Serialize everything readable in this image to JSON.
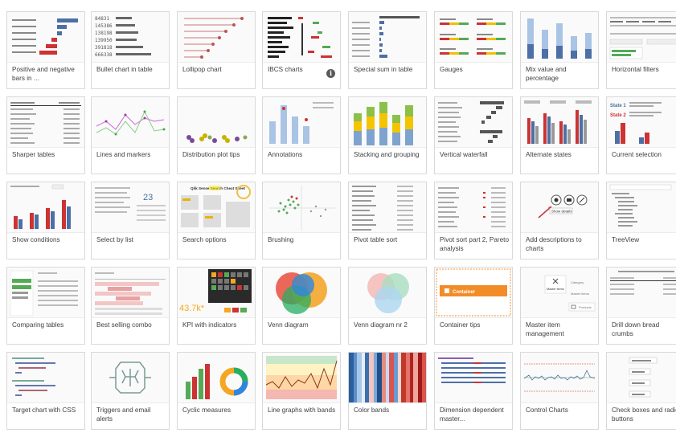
{
  "cards": [
    {
      "label": "Positive and negative bars in ..."
    },
    {
      "label": "Bullet chart in table"
    },
    {
      "label": "Lollipop chart"
    },
    {
      "label": "IBCS charts"
    },
    {
      "label": "Special sum in table"
    },
    {
      "label": "Gauges"
    },
    {
      "label": "Mix value and percentage"
    },
    {
      "label": "Horizontal filters"
    },
    {
      "label": "Sharper tables"
    },
    {
      "label": "Lines and markers"
    },
    {
      "label": "Distribution plot tips"
    },
    {
      "label": "Annotations"
    },
    {
      "label": "Stacking and grouping"
    },
    {
      "label": "Vertical waterfall"
    },
    {
      "label": "Alternate states"
    },
    {
      "label": "Current selection"
    },
    {
      "label": "Show conditions"
    },
    {
      "label": "Select by list"
    },
    {
      "label": "Search options"
    },
    {
      "label": "Brushing"
    },
    {
      "label": "Pivot table sort"
    },
    {
      "label": "Pivot sort part 2, Pareto analysis"
    },
    {
      "label": "Add descriptions to charts"
    },
    {
      "label": "TreeView"
    },
    {
      "label": "Comparing tables"
    },
    {
      "label": "Best selling combo"
    },
    {
      "label": "KPI with indicators"
    },
    {
      "label": "Venn diagram"
    },
    {
      "label": "Venn diagram nr 2"
    },
    {
      "label": "Container tips"
    },
    {
      "label": "Master item management"
    },
    {
      "label": "Drill down bread crumbs"
    },
    {
      "label": "Target chart with CSS"
    },
    {
      "label": "Triggers and email alerts"
    },
    {
      "label": "Cyclic measures"
    },
    {
      "label": "Line graphs with bands"
    },
    {
      "label": "Color bands"
    },
    {
      "label": "Dimension dependent master..."
    },
    {
      "label": "Control Charts"
    },
    {
      "label": "Check boxes and radio buttons"
    }
  ],
  "thumb_text": {
    "bullet_numbers": [
      "84831",
      "145386",
      "138198",
      "139950",
      "391818",
      "666338"
    ],
    "kpi_value": "43.7k*",
    "container_label": "Container",
    "master_items": [
      "Master items",
      "Category",
      "Master items",
      "Products"
    ],
    "show_details": "Show details",
    "state1": "State 1",
    "state2": "State 2",
    "search_title": "Qlik Sense Search Cheat Sheet",
    "select_number": "23",
    "ibcs_info": "i"
  },
  "colors": {
    "accent_blue": "#4477aa",
    "accent_red": "#cc3333",
    "container_orange": "#f28c28",
    "kpi_orange": "#f5a623",
    "border": "#d9d9d9"
  }
}
